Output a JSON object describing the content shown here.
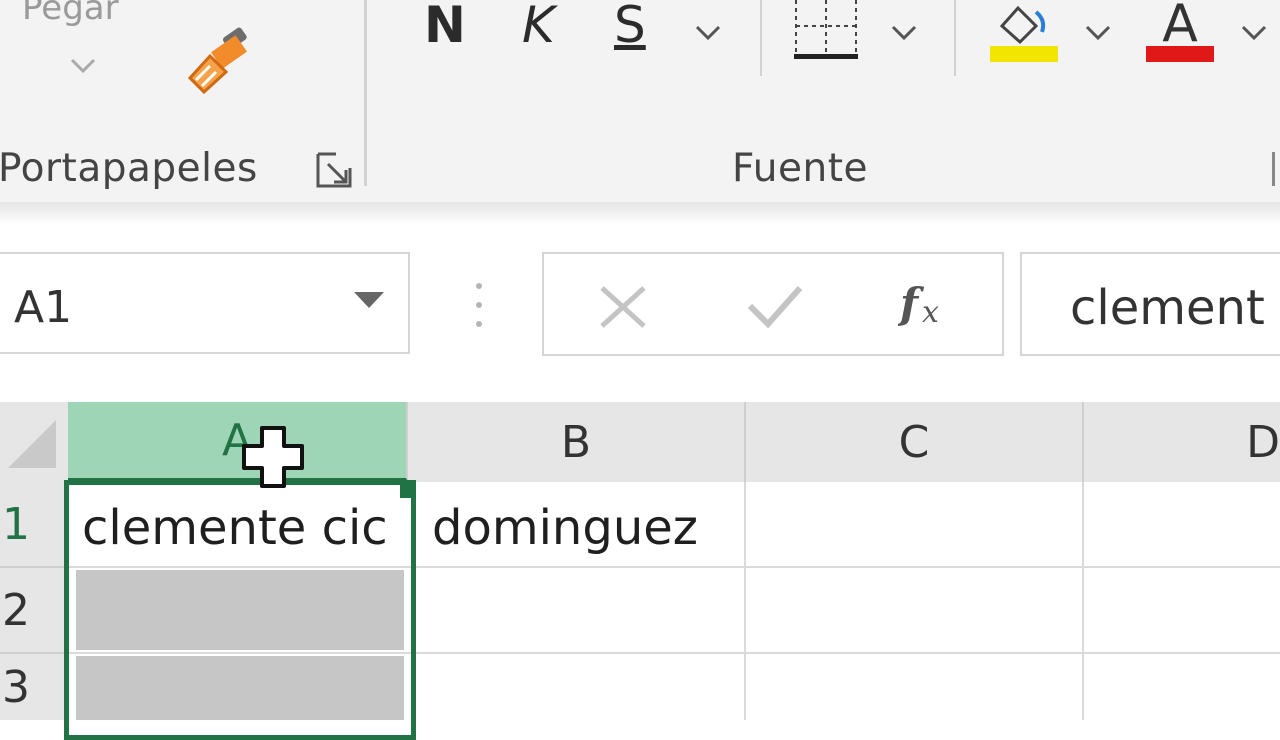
{
  "ribbon": {
    "paste_label": "Pegar",
    "clipboard_group_label": "Portapapeles",
    "font_group_label": "Fuente",
    "bold_label": "N",
    "italic_label": "K",
    "underline_label": "S",
    "font_color_letter": "A",
    "fill_color": "#f2e600",
    "font_color": "#e01818"
  },
  "formula_bar": {
    "name_box_value": "A1",
    "formula_value": "clement"
  },
  "grid": {
    "columns": [
      "A",
      "B",
      "C",
      "D"
    ],
    "rows": [
      "1",
      "2",
      "3"
    ],
    "cells": {
      "A1": "clemente cic",
      "B1": "dominguez"
    }
  },
  "colors": {
    "accent": "#217346",
    "selected_header": "#9fd5b7"
  }
}
